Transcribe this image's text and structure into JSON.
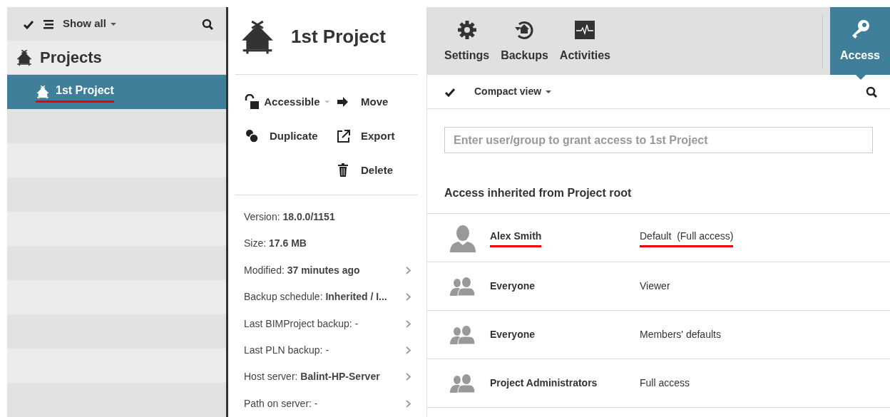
{
  "sidebar": {
    "filter_label": "Show all",
    "title": "Projects",
    "items": [
      {
        "label": "1st Project",
        "selected": true,
        "annotated": true
      }
    ]
  },
  "project": {
    "title": "1st Project",
    "actions_left": [
      {
        "kind": "lock",
        "label": "Accessible",
        "dropdown": true
      },
      {
        "kind": "duplicate",
        "label": "Duplicate",
        "dropdown": false
      }
    ],
    "actions_right": [
      {
        "kind": "move",
        "label": "Move",
        "dropdown": false
      },
      {
        "kind": "export",
        "label": "Export",
        "dropdown": false
      },
      {
        "kind": "delete",
        "label": "Delete",
        "dropdown": false
      }
    ],
    "info": [
      {
        "text": "Version: **18.0.0/1151**",
        "details": false
      },
      {
        "text": "Size: **17.6 MB**",
        "details": false
      },
      {
        "text": "Modified: **37 minutes ago**",
        "details": true
      },
      {
        "text": "Backup schedule: **Inherited / I...**",
        "details": true
      },
      {
        "text": "Last BIMProject backup: -",
        "details": true
      },
      {
        "text": "Last PLN backup: -",
        "details": true
      },
      {
        "text": "Host server: **Balint-HP-Server**",
        "details": true
      },
      {
        "text": "Path on server: -",
        "details": true
      }
    ]
  },
  "tabs": [
    {
      "kind": "settings",
      "label": "Settings",
      "selected": false
    },
    {
      "kind": "backups",
      "label": "Backups",
      "selected": false
    },
    {
      "kind": "activities",
      "label": "Activities",
      "selected": false
    },
    {
      "kind": "access",
      "label": "Access",
      "selected": true
    }
  ],
  "view_toolbar": {
    "label": "Compact view"
  },
  "search": {
    "placeholder": "Enter user/group to grant access to 1st Project"
  },
  "access_heading": "Access inherited from Project root",
  "access_rows": [
    {
      "kind": "user",
      "name": "Alex Smith",
      "role": "Default  (Full access)",
      "annotated": true
    },
    {
      "kind": "group",
      "name": "Everyone",
      "role": "Viewer",
      "annotated": false
    },
    {
      "kind": "group",
      "name": "Everyone",
      "role": "Members' defaults",
      "annotated": false
    },
    {
      "kind": "group",
      "name": "Project Administrators",
      "role": "Full access",
      "annotated": false
    }
  ]
}
